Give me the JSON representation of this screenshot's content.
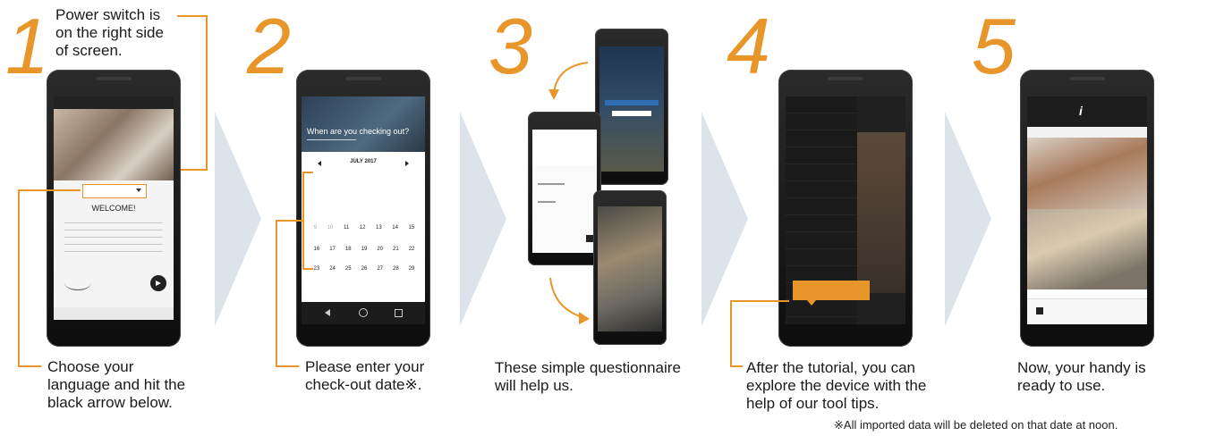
{
  "steps": [
    {
      "number": "1",
      "top_note": [
        "Power switch is",
        "on the right side",
        "of screen."
      ],
      "caption": [
        "Choose your",
        "language and hit the",
        "black arrow below."
      ],
      "screen": {
        "welcome": "WELCOME!"
      }
    },
    {
      "number": "2",
      "caption": [
        "Please enter your",
        "check-out date※."
      ],
      "screen": {
        "question": "When are you checking out?",
        "month": "JULY 2017",
        "dates_row1": [
          "16",
          "17",
          "18",
          "19",
          "20",
          "21",
          "22"
        ],
        "dates_row2": [
          "23",
          "24",
          "25",
          "26",
          "27",
          "28",
          "29"
        ],
        "dates_row0": [
          "9",
          "10",
          "11",
          "12",
          "13",
          "14",
          "15"
        ]
      }
    },
    {
      "number": "3",
      "caption": [
        "These simple questionnaire",
        "will help us."
      ]
    },
    {
      "number": "4",
      "caption": [
        "After the tutorial, you can",
        "explore the device with the",
        "help of our tool tips."
      ]
    },
    {
      "number": "5",
      "caption": [
        "Now, your handy is",
        "ready to use."
      ]
    }
  ],
  "footnote": "※All imported data will be deleted on that date at noon.",
  "colors": {
    "accent": "#e8952a",
    "chevron": "#dde3ea"
  }
}
